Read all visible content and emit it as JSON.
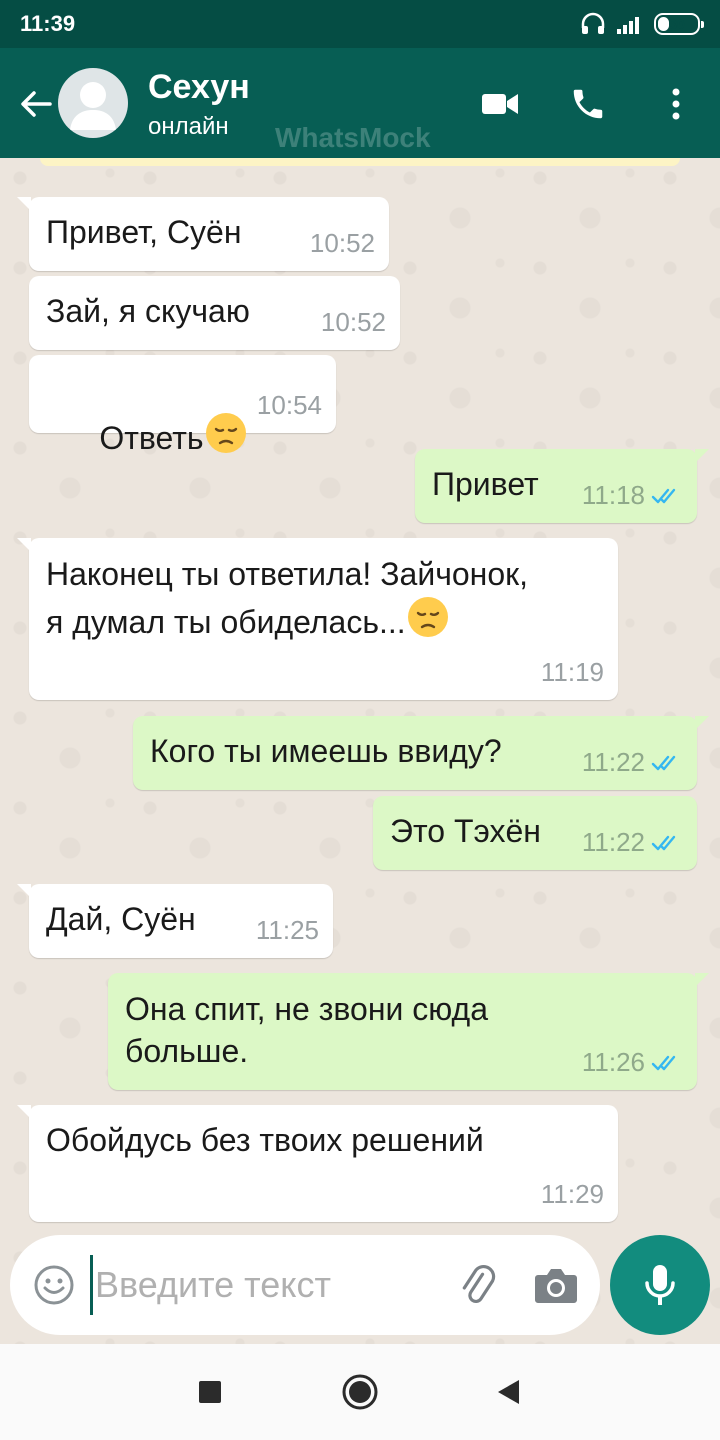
{
  "status_bar": {
    "time": "11:39",
    "battery": "30"
  },
  "header": {
    "name": "Сехун",
    "status": "онлайн",
    "watermark": "WhatsMock"
  },
  "messages": [
    {
      "dir": "in",
      "text": "Привет, Суён",
      "time": "10:52"
    },
    {
      "dir": "in",
      "text": "Зай, я скучаю",
      "time": "10:52"
    },
    {
      "dir": "in",
      "text": "Ответь",
      "emoji": "pensive-face",
      "time": "10:54"
    },
    {
      "dir": "out",
      "text": "Привет",
      "time": "11:18",
      "read": true
    },
    {
      "dir": "in",
      "text_line1": "Наконец ты ответила! Зайчонок,",
      "text_line2": "я думал ты обиделась...",
      "emoji": "pensive-face",
      "time": "11:19"
    },
    {
      "dir": "out",
      "text": "Кого ты имеешь ввиду?",
      "time": "11:22",
      "read": true
    },
    {
      "dir": "out",
      "text": "Это Тэхён",
      "time": "11:22",
      "read": true
    },
    {
      "dir": "in",
      "text": "Дай, Суён",
      "time": "11:25"
    },
    {
      "dir": "out",
      "text_line1": "Она спит, не звони сюда",
      "text_line2": "больше.",
      "time": "11:26",
      "read": true
    },
    {
      "dir": "in",
      "text": "Обойдусь без твоих решений",
      "time": "11:29"
    }
  ],
  "input": {
    "placeholder": "Введите текст"
  },
  "colors": {
    "header": "#075e54",
    "status_bar": "#054d44",
    "incoming": "#ffffff",
    "outgoing": "#dcf8c6",
    "read_tick": "#34b7f1",
    "mic_button": "#128c7e"
  },
  "icons": [
    "back-arrow-icon",
    "avatar-placeholder",
    "video-call-icon",
    "phone-icon",
    "more-options-icon",
    "emoji-icon",
    "attach-icon",
    "camera-icon",
    "mic-icon",
    "read-receipt-icon"
  ]
}
